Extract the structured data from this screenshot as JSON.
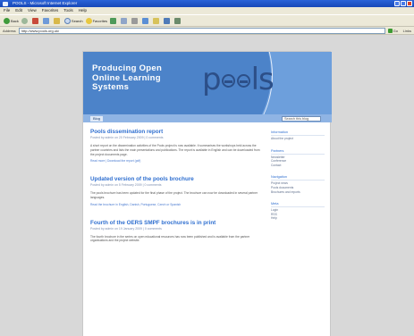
{
  "window": {
    "title": "POOLS - Microsoft Internet Explorer"
  },
  "menu": [
    "File",
    "Edit",
    "View",
    "Favorites",
    "Tools",
    "Help"
  ],
  "toolbar": {
    "back": "Back",
    "search": "Search",
    "favorites": "Favorites"
  },
  "address": {
    "label": "Address",
    "value": "http://www.pools.org.uk/",
    "go": "Go",
    "links": "Links"
  },
  "banner": {
    "tagline": "Producing Open Online Learning Systems",
    "logo_pre": "p",
    "logo_post": "ls"
  },
  "nav": {
    "tab": "Blog",
    "search_placeholder": "Search this blog"
  },
  "posts": [
    {
      "title": "Pools dissemination report",
      "meta": "Posted by admin on 20 February 2009 | 0 comments",
      "body": "A short report on the dissemination activities of the Pools project is now available. It summarises the workshops held across the partner countries and lists the main presentations and publications. The report is available in English and can be downloaded from the project documents page.",
      "link": "Read more | Download the report (pdf)"
    },
    {
      "title": "Updated version of the pools brochure",
      "meta": "Posted by admin on 5 February 2009 | 0 comments",
      "body": "The pools brochure has been updated for the final phase of the project. The brochure can now be downloaded in several partner languages.",
      "link": "Read the brochure in English, Danish, Portuguese, Czech or Spanish"
    },
    {
      "title": "Fourth of the OERS SMPF brochures is in print",
      "meta": "Posted by admin on 19 January 2009 | 0 comments",
      "body": "The fourth brochure in the series on open educational resources has now been published and is available from the partner organisations and the project website.",
      "link": ""
    }
  ],
  "sidebar": [
    {
      "heading": "Information",
      "items": [
        "About the project"
      ]
    },
    {
      "heading": "Partners",
      "items": [
        "Newsletter",
        "Conference",
        "Contact"
      ]
    },
    {
      "heading": "Navigation",
      "items": [
        "Project news",
        "Pools documents",
        "Brochures and reports"
      ]
    },
    {
      "heading": "Meta",
      "items": [
        "Login",
        "RSS",
        "Help"
      ]
    }
  ]
}
